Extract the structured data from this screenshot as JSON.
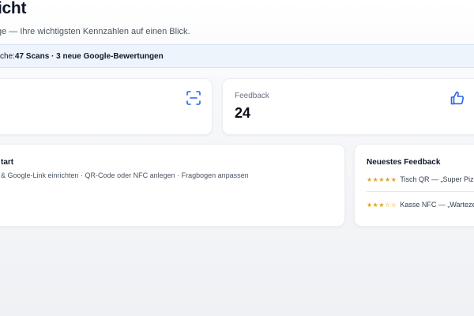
{
  "header": {
    "title": "icht",
    "subtitle": "ge — Ihre wichtigsten Kennzahlen auf einen Blick."
  },
  "banner": {
    "prefix": "che: ",
    "highlight": "47 Scans · 3 neue Google-Bewertungen"
  },
  "stats": {
    "feedback": {
      "label": "Feedback",
      "value": "24"
    }
  },
  "icons": {
    "scan": "qr-scan-icon",
    "thumbs_up": "thumbs-up-icon",
    "accent_color": "#2563eb"
  },
  "start_card": {
    "title": "tart",
    "steps": "& Google-Link einrichten · QR-Code oder NFC anlegen · Fragbogen anpassen"
  },
  "newest_feedback": {
    "title": "Neuestes Feedback",
    "items": [
      {
        "stars": "★★★★★",
        "text": "Tisch QR — „Super Pizza"
      },
      {
        "stars": "★★★☆☆",
        "text": "Kasse NFC — „Wartezeit"
      }
    ],
    "star_color": "#e0a21b"
  }
}
